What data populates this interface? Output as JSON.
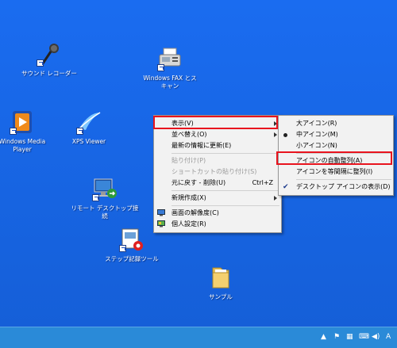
{
  "desktop_icons": [
    {
      "name": "sound-recorder",
      "label": "サウンド レコーダー"
    },
    {
      "name": "windows-fax-scan",
      "label": "Windows FAX とス\nキャン"
    },
    {
      "name": "windows-media-player",
      "label": "Windows Media\nPlayer"
    },
    {
      "name": "xps-viewer",
      "label": "XPS Viewer"
    },
    {
      "name": "remote-desktop",
      "label": "リモート デスクトップ接\n続"
    },
    {
      "name": "steps-recorder",
      "label": "ステップ記録ツール"
    },
    {
      "name": "sample-folder",
      "label": "サンプル"
    }
  ],
  "context_menu": {
    "items": [
      {
        "label": "表示(V)",
        "submenu": true
      },
      {
        "label": "並べ替え(O)",
        "submenu": true
      },
      {
        "label": "最新の情報に更新(E)"
      },
      {
        "label": "貼り付け(P)",
        "disabled": true
      },
      {
        "label": "ショートカットの貼り付け(S)",
        "disabled": true
      },
      {
        "label": "元に戻す - 削除(U)",
        "shortcut": "Ctrl+Z"
      },
      {
        "label": "新規作成(X)",
        "submenu": true
      },
      {
        "label": "画面の解像度(C)"
      },
      {
        "label": "個人設定(R)"
      }
    ]
  },
  "view_submenu": {
    "items": [
      {
        "label": "大アイコン(R)"
      },
      {
        "label": "中アイコン(M)",
        "selected": true
      },
      {
        "label": "小アイコン(N)"
      },
      {
        "label": "アイコンの自動整列(A)"
      },
      {
        "label": "アイコンを等間隔に整列(I)"
      },
      {
        "label": "デスクトップ アイコンの表示(D)",
        "checked": true
      }
    ]
  },
  "taskbar": {
    "ime_label": "A",
    "icons": [
      "chevron-up-icon",
      "flag-icon",
      "network-icon",
      "keyboard-icon",
      "speaker-icon"
    ]
  },
  "colors": {
    "desktop": "#1565e0",
    "taskbar": "#2a8ad8",
    "highlight": "#e8141e"
  }
}
